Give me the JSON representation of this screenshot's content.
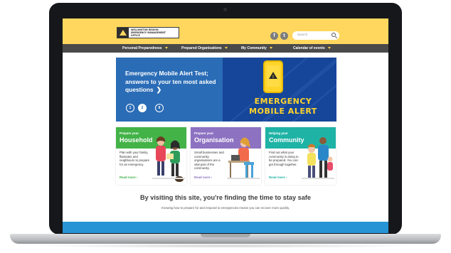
{
  "header": {
    "logo_text": "WELLINGTON REGION\nEMERGENCY MANAGEMENT\nOFFICE",
    "social": [
      {
        "icon": "facebook-icon",
        "glyph": "f"
      },
      {
        "icon": "twitter-icon",
        "glyph": "t"
      }
    ],
    "search_placeholder": "Search"
  },
  "nav": {
    "items": [
      {
        "label": "Personal Preparedness"
      },
      {
        "label": "Prepared Organisations"
      },
      {
        "label": "My Community"
      },
      {
        "label": "Calendar of events"
      }
    ]
  },
  "hero": {
    "title": "Emergency Mobile Alert Test; answers to your ten most asked questions",
    "arrow": "❯",
    "pager": [
      "1",
      "2",
      "II"
    ],
    "active_page": "2",
    "art_line1": "EMERGENCY",
    "art_line2": "MOBILE ALERT",
    "art_warning": "!"
  },
  "cards": [
    {
      "kicker": "Prepare your",
      "title": "Household",
      "body": "Plan with your family, flatmates and neighbours to prepare for an emergency.",
      "link": "Read more ›",
      "color": "#43b348"
    },
    {
      "kicker": "Prepare your",
      "title": "Organisation",
      "body": "Small businesses and community organisations are a vital part of the community.",
      "link": "Read more ›",
      "color": "#8d72c2"
    },
    {
      "kicker": "Helping your",
      "title": "Community",
      "body": "Find out what your community is doing to be prepared. You can get through together.",
      "link": "Read more ›",
      "color": "#1fb3a6"
    }
  ],
  "tagline": "By visiting this site, you're finding the time to stay safe",
  "subline": "Knowing how to prepare for and respond to emergencies means you can recover more quickly.",
  "colors": {
    "header_yellow": "#ffd75e",
    "nav_dark": "#4a4a4a",
    "hero_blue": "#2a6cb6",
    "alert_yellow": "#ffd42a",
    "bottom_blue": "#2794d6"
  }
}
